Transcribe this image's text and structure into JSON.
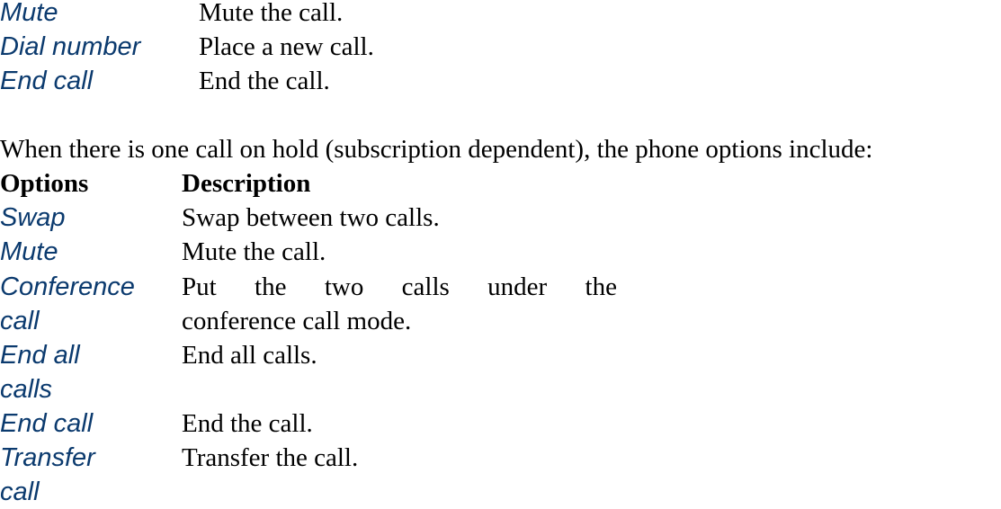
{
  "top_table": {
    "rows": [
      {
        "option": "Mute",
        "description": "Mute the call."
      },
      {
        "option": "Dial number",
        "description": "Place a new call."
      },
      {
        "option": "End call",
        "description": "End the call."
      }
    ]
  },
  "intro_paragraph": "When there is one call on hold (subscription dependent), the phone options include:",
  "hold_table": {
    "header": {
      "option": "Options",
      "description": "Description"
    },
    "rows": [
      {
        "option": "Swap",
        "description": "Swap between two calls."
      },
      {
        "option": "Mute",
        "description": "Mute the call."
      },
      {
        "option_line1": "Conference",
        "option_line2": "call",
        "description_words": [
          "Put",
          "the",
          "two",
          "calls",
          "under",
          "the"
        ],
        "description_line2": "conference call mode."
      },
      {
        "option_line1": "End all",
        "option_line2": "calls",
        "description": "End all calls."
      },
      {
        "option": "End call",
        "description": "End the call."
      },
      {
        "option_line1": "Transfer",
        "option_line2": "call",
        "description": "Transfer the call."
      }
    ]
  }
}
